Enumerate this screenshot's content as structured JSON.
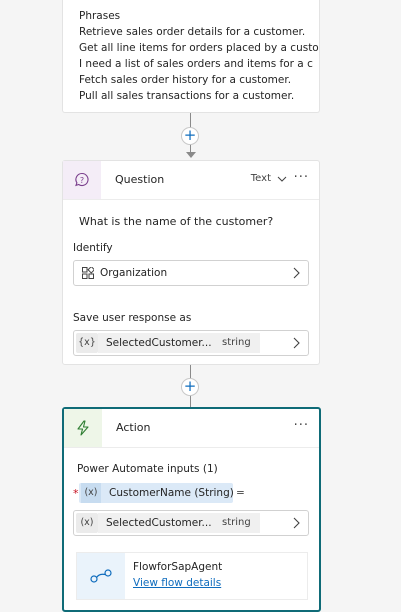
{
  "phrases": {
    "heading": "Phrases",
    "items": [
      "Retrieve sales order details for a customer.",
      "Get all line items for orders placed by a custo",
      "I need a list of sales orders and items for a c",
      "Fetch sales order history for a customer.",
      "Pull all sales transactions for a customer."
    ]
  },
  "question_node": {
    "title": "Question",
    "type_label": "Text",
    "more_label": "···",
    "question_text": "What is the name of the customer?",
    "identify_label": "Identify",
    "identify_value": "Organization",
    "save_label": "Save user response as",
    "variable_icon": "{x}",
    "variable_name": "SelectedCustomer...",
    "variable_type": "string"
  },
  "action_node": {
    "title": "Action",
    "more_label": "···",
    "inputs_label": "Power Automate inputs (1)",
    "required_marker": "*",
    "param_icon": "(x)",
    "param_name": "CustomerName (String)",
    "equals": "=",
    "variable_icon": "(x)",
    "variable_name": "SelectedCustomer...",
    "variable_type": "string",
    "flow_name": "FlowforSapAgent",
    "flow_link": "View flow details"
  },
  "connectors": {
    "add_label": "+"
  },
  "colors": {
    "accent": "#0f6cbd",
    "selected_border": "#0f6b77",
    "question_icon_bg": "#f4edf7",
    "action_icon_bg": "#eef6e8"
  },
  "icons": {
    "question": "question-bubble-icon",
    "action": "lightning-icon",
    "entity": "grid-apps-icon",
    "chevron": "chevron-right-icon",
    "flow": "flow-icon"
  }
}
